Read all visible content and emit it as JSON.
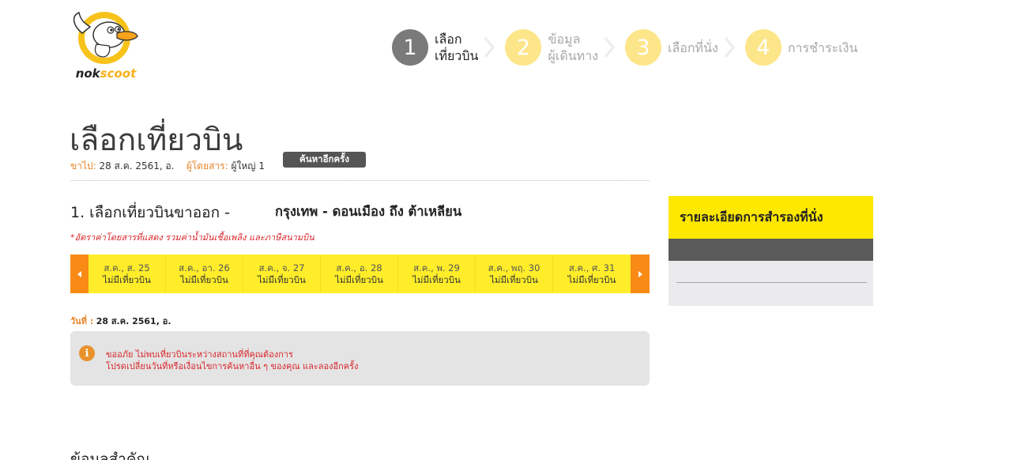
{
  "logo": {
    "text": "nokscoot",
    "name": "nokscoot-logo"
  },
  "steps": [
    {
      "number": "1",
      "line1": "เลือก",
      "line2": "เที่ยวบิน",
      "state": "active"
    },
    {
      "number": "2",
      "line1": "ข้อมูล",
      "line2": "ผู้เดินทาง",
      "state": "inactive"
    },
    {
      "number": "3",
      "line1": "เลือกที่นั่ง",
      "line2": "",
      "state": "inactive"
    },
    {
      "number": "4",
      "line1": "การชำระเงิน",
      "line2": "",
      "state": "inactive"
    }
  ],
  "header": {
    "title": "เลือกเที่ยวบิน",
    "depart_label": "ขาไป:",
    "depart_value": "28 ส.ค. 2561, อ.",
    "passenger_label": "ผู้โดยสาร:",
    "passenger_value": "ผู้ใหญ่ 1",
    "search_again": "ค้นหาอีกครั้ง"
  },
  "section": {
    "title": "1. เลือกเที่ยวบินขาออก -",
    "route": "กรุงเทพ - ดอนเมือง  ถึง  ต้าเหลียน",
    "fare_note": "*อัตราค่าโดยสารที่แสดง รวมค่าน้ำมันเชื้อเพลิง และภาษีสนามบิน"
  },
  "dates": [
    {
      "date": "ส.ค., ส. 25",
      "status": "ไม่มีเที่ยวบิน"
    },
    {
      "date": "ส.ค., อา. 26",
      "status": "ไม่มีเที่ยวบิน"
    },
    {
      "date": "ส.ค., จ. 27",
      "status": "ไม่มีเที่ยวบิน"
    },
    {
      "date": "ส.ค., อ. 28",
      "status": "ไม่มีเที่ยวบิน"
    },
    {
      "date": "ส.ค., พ. 29",
      "status": "ไม่มีเที่ยวบิน"
    },
    {
      "date": "ส.ค., พฤ. 30",
      "status": "ไม่มีเที่ยวบิน"
    },
    {
      "date": "ส.ค., ศ. 31",
      "status": "ไม่มีเที่ยวบิน"
    }
  ],
  "selected_date": {
    "label": "วันที่ :",
    "value": "28 ส.ค. 2561, อ."
  },
  "alert": {
    "icon": "i",
    "line1": "ขออภัย ไม่พบเที่ยวบินระหว่างสถานที่ที่คุณต้องการ",
    "line2": "โปรดเปลี่ยนวันที่หรือเงื่อนไขการค้นหาอื่น ๆ ของคุณ และลองอีกครั้ง"
  },
  "important_title": "ข้อมูลสำคัญ",
  "panel": {
    "title": "รายละเอียดการสำรองที่นั่ง"
  },
  "colors": {
    "brand_yellow": "#ffed2a",
    "arrow_orange": "#f98a16",
    "label_orange": "#e8852b",
    "alert_red": "#d8262b",
    "step_active": "#7a7a7a",
    "step_inactive": "#fde68a"
  }
}
